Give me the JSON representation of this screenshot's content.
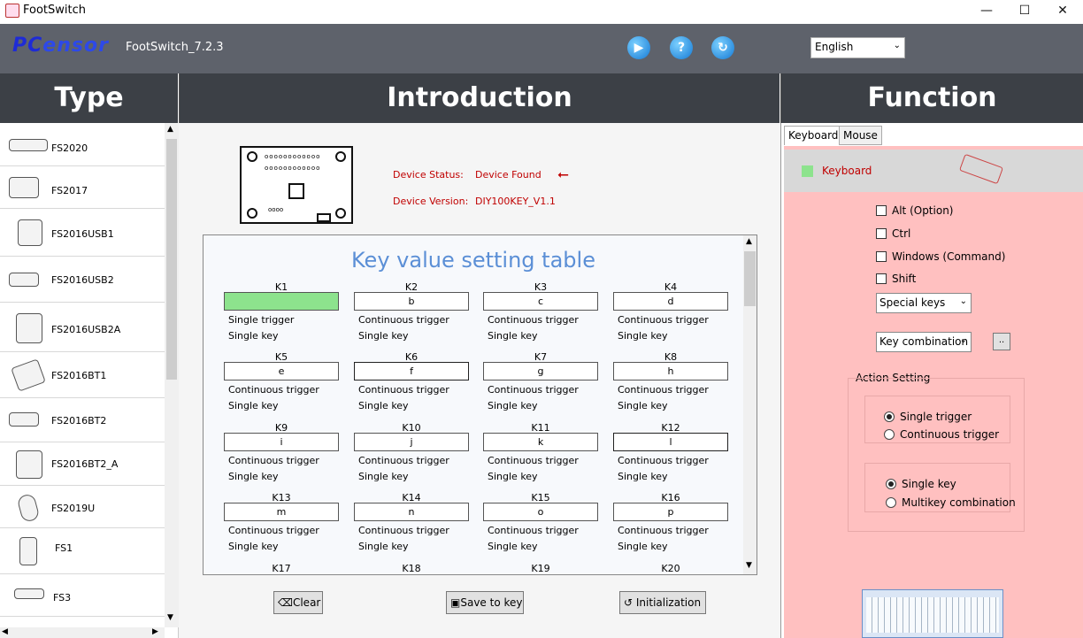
{
  "window": {
    "title": "FootSwitch",
    "minimize": "—",
    "maximize": "☐",
    "close": "✕"
  },
  "header": {
    "logo_pc": "PC",
    "logo_rest": "ensor",
    "version": "FootSwitch_7.2.3",
    "language": "English"
  },
  "sections": {
    "type": "Type",
    "introduction": "Introduction",
    "function": "Function"
  },
  "sidebar": {
    "items": [
      {
        "label": "FS2020"
      },
      {
        "label": "FS2017"
      },
      {
        "label": "FS2016USB1"
      },
      {
        "label": "FS2016USB2"
      },
      {
        "label": "FS2016USB2A"
      },
      {
        "label": "FS2016BT1"
      },
      {
        "label": "FS2016BT2"
      },
      {
        "label": "FS2016BT2_A"
      },
      {
        "label": "FS2019U"
      },
      {
        "label": "FS1"
      },
      {
        "label": "FS3"
      }
    ]
  },
  "device": {
    "status_label": "Device Status:",
    "status_value": "Device Found",
    "version_label": "Device Version:",
    "version_value": "DIY100KEY_V1.1"
  },
  "table": {
    "title": "Key value setting table",
    "keys": [
      {
        "name": "K1",
        "value": "",
        "trigger": "Single trigger",
        "type": "Single key"
      },
      {
        "name": "K2",
        "value": "b",
        "trigger": "Continuous trigger",
        "type": "Single key"
      },
      {
        "name": "K3",
        "value": "c",
        "trigger": "Continuous trigger",
        "type": "Single key"
      },
      {
        "name": "K4",
        "value": "d",
        "trigger": "Continuous trigger",
        "type": "Single key"
      },
      {
        "name": "K5",
        "value": "e",
        "trigger": "Continuous trigger",
        "type": "Single key"
      },
      {
        "name": "K6",
        "value": "f",
        "trigger": "Continuous trigger",
        "type": "Single key"
      },
      {
        "name": "K7",
        "value": "g",
        "trigger": "Continuous trigger",
        "type": "Single key"
      },
      {
        "name": "K8",
        "value": "h",
        "trigger": "Continuous trigger",
        "type": "Single key"
      },
      {
        "name": "K9",
        "value": "i",
        "trigger": "Continuous trigger",
        "type": "Single key"
      },
      {
        "name": "K10",
        "value": "j",
        "trigger": "Continuous trigger",
        "type": "Single key"
      },
      {
        "name": "K11",
        "value": "k",
        "trigger": "Continuous trigger",
        "type": "Single key"
      },
      {
        "name": "K12",
        "value": "l",
        "trigger": "Continuous trigger",
        "type": "Single key"
      },
      {
        "name": "K13",
        "value": "m",
        "trigger": "Continuous trigger",
        "type": "Single key"
      },
      {
        "name": "K14",
        "value": "n",
        "trigger": "Continuous trigger",
        "type": "Single key"
      },
      {
        "name": "K15",
        "value": "o",
        "trigger": "Continuous trigger",
        "type": "Single key"
      },
      {
        "name": "K16",
        "value": "p",
        "trigger": "Continuous trigger",
        "type": "Single key"
      },
      {
        "name": "K17",
        "value": "",
        "trigger": "",
        "type": ""
      },
      {
        "name": "K18",
        "value": "",
        "trigger": "",
        "type": ""
      },
      {
        "name": "K19",
        "value": "",
        "trigger": "",
        "type": ""
      },
      {
        "name": "K20",
        "value": "",
        "trigger": "",
        "type": ""
      }
    ]
  },
  "buttons": {
    "clear": "Clear",
    "save": "Save to key",
    "init": "Initialization"
  },
  "function": {
    "tabs": [
      "Keyboard",
      "Mouse"
    ],
    "mode_label": "Keyboard",
    "modifiers": [
      "Alt (Option)",
      "Ctrl",
      "Windows (Command)",
      "Shift"
    ],
    "special_keys": "Special keys",
    "key_combination": "Key combination",
    "browse": "..",
    "action_setting": "Action Setting",
    "trigger_options": [
      "Single trigger",
      "Continuous trigger"
    ],
    "key_options": [
      "Single key",
      "Multikey  combination"
    ]
  },
  "colors": {
    "header": "#5e626b",
    "section": "#3c4046",
    "panel": "#ffc0c0",
    "selected_key": "#8de38d",
    "status": "#c00000"
  }
}
